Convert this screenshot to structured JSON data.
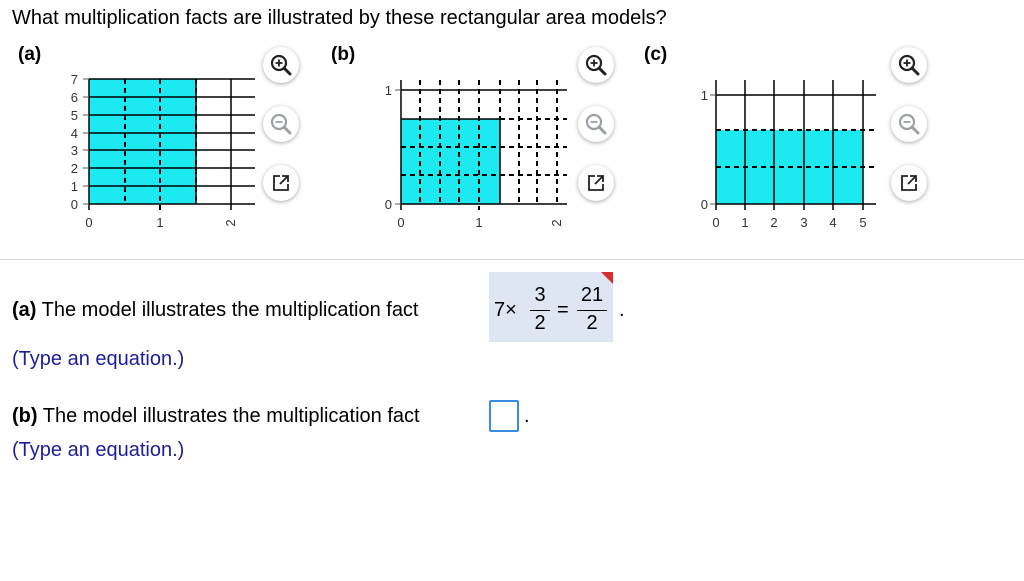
{
  "question": "What multiplication facts are illustrated by these rectangular area models?",
  "parts": {
    "a_label": "(a)",
    "b_label": "(b)",
    "c_label": "(c)"
  },
  "graphs": {
    "a": {
      "x_ticks": [
        "0",
        "1",
        "2"
      ],
      "y_ticks": [
        "0",
        "1",
        "2",
        "3",
        "4",
        "5",
        "6",
        "7"
      ]
    },
    "b": {
      "x_ticks": [
        "0",
        "1",
        "2"
      ],
      "y_ticks": [
        "0",
        "1"
      ]
    },
    "c": {
      "x_ticks": [
        "0",
        "1",
        "2",
        "3",
        "4",
        "5"
      ],
      "y_ticks": [
        "0",
        "1"
      ]
    },
    "fill_color": "#1de9f0"
  },
  "icons": {
    "zoom_in": "zoom-in-icon",
    "zoom_out": "zoom-out-icon",
    "popout": "popout-icon"
  },
  "answer_a": {
    "label": "(a)",
    "text": "The model illustrates the multiplication fact",
    "lhs": "7×",
    "num1": "3",
    "den1": "2",
    "equals": "=",
    "num2": "21",
    "den2": "2",
    "period": ".",
    "hint": "(Type an equation.)"
  },
  "answer_b": {
    "label": "(b)",
    "text": "The model illustrates the multiplication fact",
    "value": "",
    "period": ".",
    "hint": "(Type an equation.)"
  }
}
